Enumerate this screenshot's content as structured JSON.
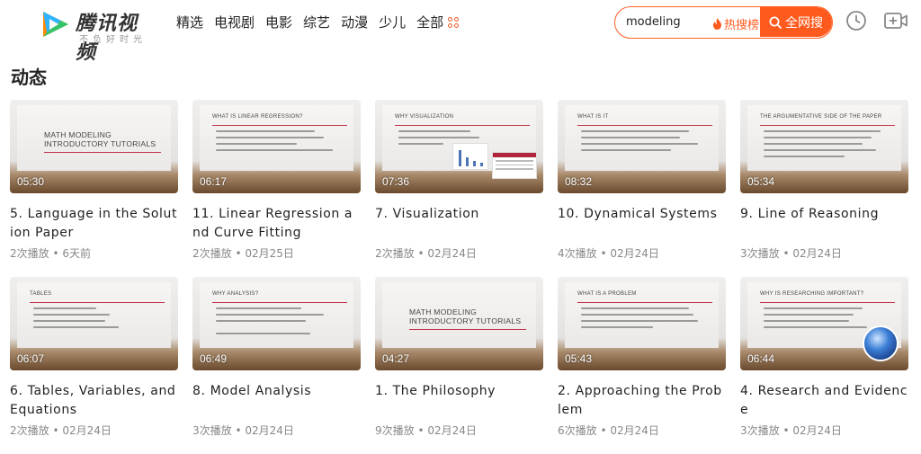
{
  "header": {
    "logo_text": "腾讯视频",
    "logo_slogan": "不负好时光",
    "nav": [
      "精选",
      "电视剧",
      "电影",
      "综艺",
      "动漫",
      "少儿",
      "全部"
    ],
    "search": {
      "value": "modeling",
      "hot_label": "热搜榜",
      "button_label": "全网搜"
    },
    "colors": {
      "accent": "#ff5a1e"
    }
  },
  "section": {
    "title": "动态"
  },
  "videos": [
    {
      "title": "5. Language in the Solution Paper",
      "meta": "2次播放 • 6天前",
      "duration": "05:30",
      "slide": "MATH MODELING INTRODUCTORY TUTORIALS"
    },
    {
      "title": "11. Linear Regression and Curve Fitting",
      "meta": "2次播放 • 02月25日",
      "duration": "06:17",
      "slide": "WHAT IS LINEAR REGRESSION?"
    },
    {
      "title": "7. Visualization",
      "meta": "2次播放 • 02月24日",
      "duration": "07:36",
      "slide": "WHY VISUALIZATION"
    },
    {
      "title": "10. Dynamical Systems",
      "meta": "4次播放 • 02月24日",
      "duration": "08:32",
      "slide": "WHAT IS IT"
    },
    {
      "title": "9. Line of Reasoning",
      "meta": "3次播放 • 02月24日",
      "duration": "05:34",
      "slide": "THE ARGUMENTATIVE SIDE OF THE PAPER"
    },
    {
      "title": "6. Tables, Variables, and Equations",
      "meta": "2次播放 • 02月24日",
      "duration": "06:07",
      "slide": "TABLES"
    },
    {
      "title": "8. Model Analysis",
      "meta": "3次播放 • 02月24日",
      "duration": "06:49",
      "slide": "WHY ANALYSIS?"
    },
    {
      "title": "1. The Philosophy",
      "meta": "9次播放 • 02月24日",
      "duration": "04:27",
      "slide": "MATH MODELING INTRODUCTORY TUTORIALS"
    },
    {
      "title": "2. Approaching the Problem",
      "meta": "6次播放 • 02月24日",
      "duration": "05:43",
      "slide": "WHAT IS A PROBLEM"
    },
    {
      "title": "4. Research and Evidence",
      "meta": "3次播放 • 02月24日",
      "duration": "06:44",
      "slide": "WHY IS RESEARCHING IMPORTANT?"
    }
  ]
}
